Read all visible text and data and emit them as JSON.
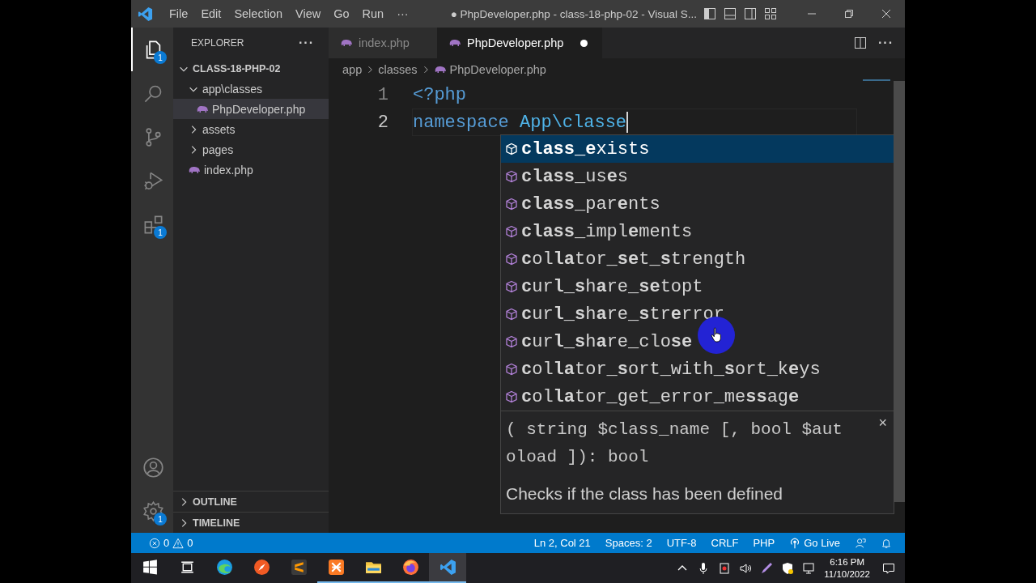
{
  "title_bar": {
    "menu": [
      "File",
      "Edit",
      "Selection",
      "View",
      "Go",
      "Run"
    ],
    "overflow": "···",
    "title": "● PhpDeveloper.php - class-18-php-02 - Visual S..."
  },
  "activity_bar": {
    "items": [
      {
        "kind": "files",
        "selected": true,
        "badge": "1"
      },
      {
        "kind": "search",
        "selected": false
      },
      {
        "kind": "source-control",
        "selected": false
      },
      {
        "kind": "run-debug",
        "selected": false
      },
      {
        "kind": "extensions",
        "selected": false,
        "badge": "1"
      }
    ],
    "bottom": [
      {
        "kind": "account"
      },
      {
        "kind": "settings",
        "badge": "1"
      }
    ]
  },
  "explorer": {
    "title": "EXPLORER",
    "more": "···",
    "root": {
      "label": "CLASS-18-PHP-02",
      "expanded": true,
      "children": [
        {
          "label": "app\\classes",
          "kind": "folder",
          "expanded": true,
          "selected": false,
          "children": [
            {
              "label": "PhpDeveloper.php",
              "kind": "php",
              "selected": true
            }
          ]
        },
        {
          "label": "assets",
          "kind": "folder",
          "expanded": false,
          "selected": false
        },
        {
          "label": "pages",
          "kind": "folder",
          "expanded": false,
          "selected": false
        },
        {
          "label": "index.php",
          "kind": "php",
          "selected": false
        }
      ]
    },
    "sections": [
      {
        "label": "OUTLINE",
        "expanded": false
      },
      {
        "label": "TIMELINE",
        "expanded": false
      }
    ]
  },
  "tabs": [
    {
      "label": "index.php",
      "selected": false,
      "modified": false
    },
    {
      "label": "PhpDeveloper.php",
      "selected": true,
      "modified": true
    }
  ],
  "breadcrumbs": [
    "app",
    "classes",
    "PhpDeveloper.php"
  ],
  "code_lines": [
    {
      "number": "1",
      "current": false,
      "tokens": [
        {
          "text": "<?php",
          "kind": "keyword"
        }
      ]
    },
    {
      "number": "2",
      "current": true,
      "tokens": [
        {
          "text": "namespace ",
          "kind": "keyword"
        },
        {
          "text": "App\\classe",
          "kind": "name"
        }
      ]
    }
  ],
  "suggestions": [
    {
      "label": "**class**_**e**xists",
      "selected": true
    },
    {
      "label": "**class**_us**e**s",
      "selected": false
    },
    {
      "label": "**class**_par**e**nts",
      "selected": false
    },
    {
      "label": "**class**_impl**e**ments",
      "selected": false
    },
    {
      "label": "**c**ol**la**tor_**se**t_**s**trength",
      "selected": false
    },
    {
      "label": "**c**ur**l**_**s**h**a**re_**se**topt",
      "selected": false
    },
    {
      "label": "**c**ur**l**_**s**h**a**re_**s**tr**e**rror",
      "selected": false
    },
    {
      "label": "**c**ur**l**_**s**h**a**re_clo**se**",
      "selected": false
    },
    {
      "label": "**c**ol**la**tor_**s**ort_with_**s**ort_k**e**ys",
      "selected": false
    },
    {
      "label": "**c**ol**la**tor_get_error_me**ss**ag**e**",
      "selected": false
    }
  ],
  "details": {
    "signature": [
      "( string $class_name [, bool $aut",
      "oload ]): bool"
    ],
    "description": "Checks if the class has been defined",
    "close": "×"
  },
  "status_bar": {
    "errors": "0",
    "warnings": "0",
    "items": [
      {
        "text": "Ln 2, Col 21",
        "kind": "text"
      },
      {
        "text": "Spaces: 2",
        "kind": "text"
      },
      {
        "text": "UTF-8",
        "kind": "text"
      },
      {
        "text": "CRLF",
        "kind": "text"
      },
      {
        "text": "PHP",
        "kind": "text"
      },
      {
        "text": "Go Live",
        "kind": "live"
      }
    ]
  },
  "taskbar": {
    "apps": [
      {
        "kind": "start",
        "running": false
      },
      {
        "kind": "task-view",
        "running": false
      },
      {
        "kind": "edge",
        "running": false
      },
      {
        "kind": "compass",
        "running": false
      },
      {
        "kind": "sublime",
        "running": false
      },
      {
        "kind": "xampp",
        "running": true
      },
      {
        "kind": "folder",
        "running": true
      },
      {
        "kind": "firefox",
        "running": true
      },
      {
        "kind": "code",
        "running": true,
        "selected": true
      }
    ],
    "time": "6:16 PM",
    "date": "11/10/2022"
  }
}
